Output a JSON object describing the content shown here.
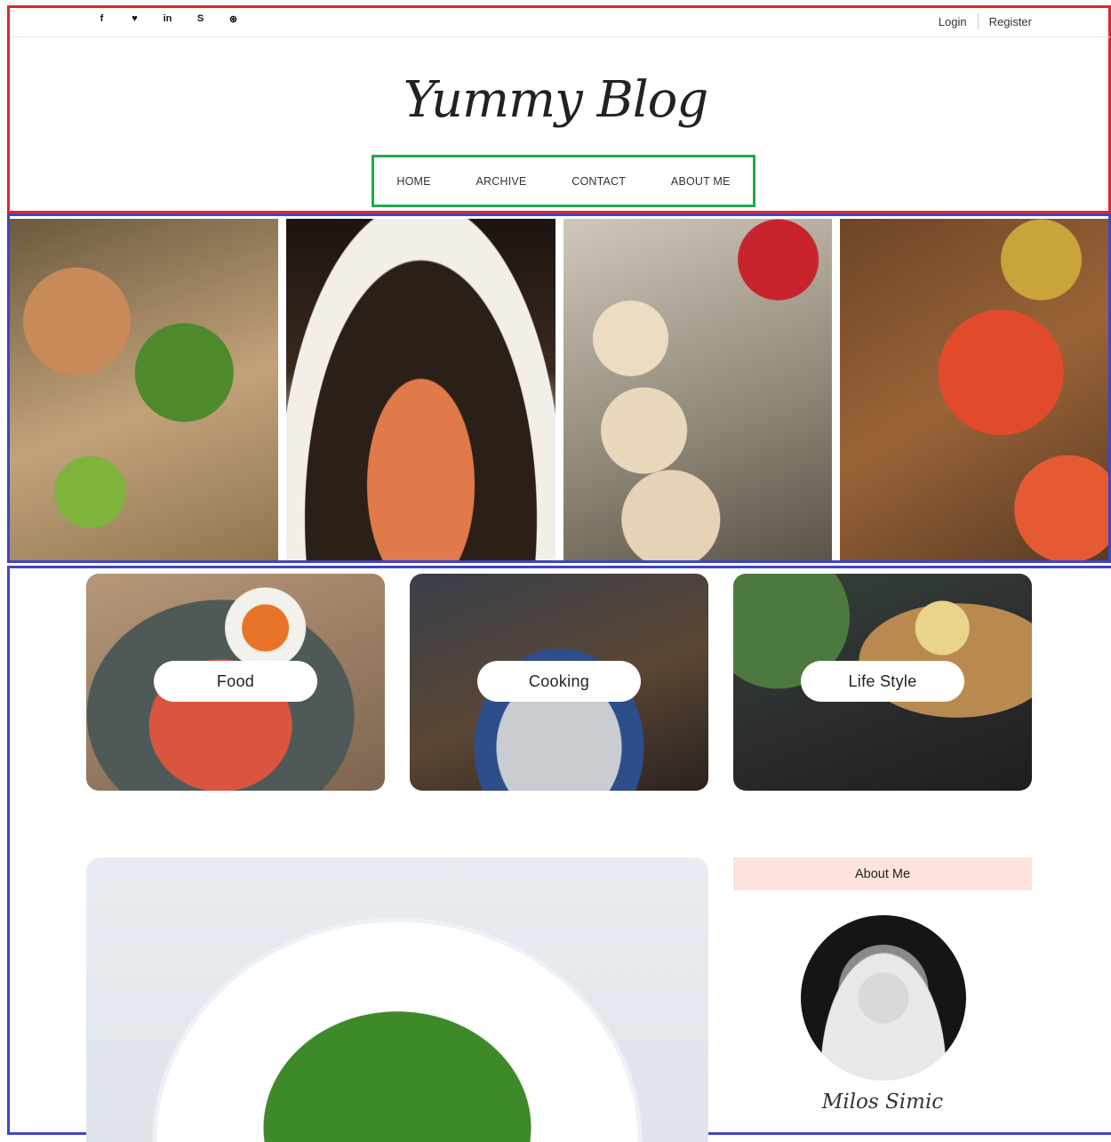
{
  "header": {
    "social_icons": [
      {
        "name": "facebook-icon",
        "glyph": "f"
      },
      {
        "name": "twitter-icon",
        "glyph": "♥"
      },
      {
        "name": "linkedin-icon",
        "glyph": "in"
      },
      {
        "name": "skype-icon",
        "glyph": "S"
      },
      {
        "name": "dribbble-icon",
        "glyph": "⊛"
      }
    ],
    "login_label": "Login",
    "register_label": "Register",
    "logo": "Yummy Blog"
  },
  "nav": {
    "items": [
      "HOME",
      "ARCHIVE",
      "CONTACT",
      "ABOUT ME"
    ]
  },
  "categories": [
    {
      "label": "Food"
    },
    {
      "label": "Cooking"
    },
    {
      "label": "Life Style"
    }
  ],
  "sidebar": {
    "title": "About Me",
    "author_name": "Milos Simic"
  },
  "colors": {
    "annotation_red": "#e0262c",
    "annotation_blue": "#3f45c4",
    "annotation_green": "#22a84a",
    "sidebar_title_bg": "#fde3dc"
  }
}
